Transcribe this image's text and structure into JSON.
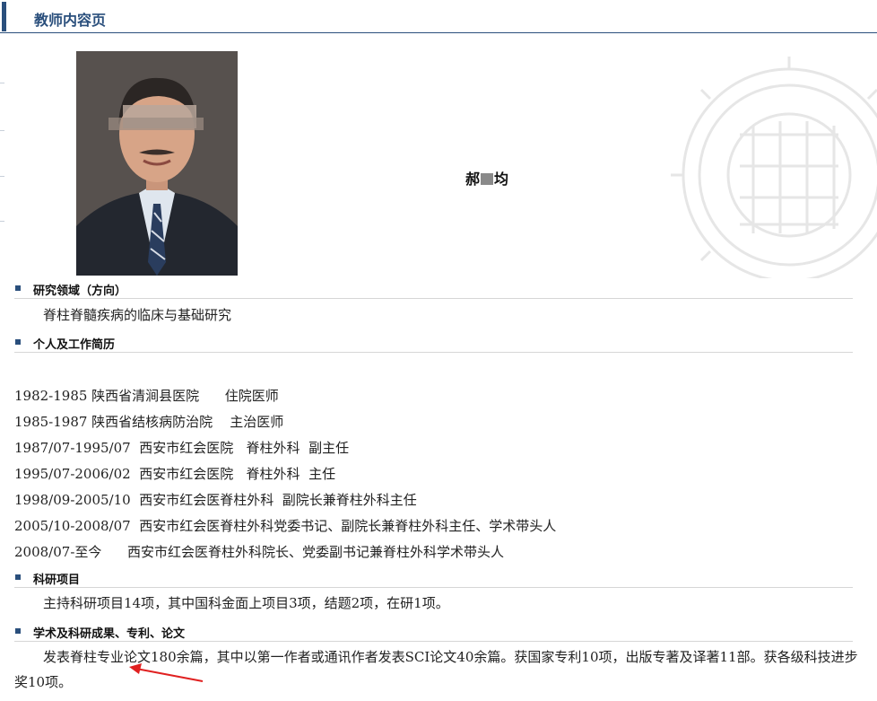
{
  "header": {
    "title": "教师内容页"
  },
  "teacher": {
    "name_part1": "郝",
    "name_part2": "均"
  },
  "sections": {
    "research_area": {
      "title": "研究领域（方向）",
      "text": "脊柱脊髓疾病的临床与基础研究"
    },
    "career": {
      "title": "个人及工作简历",
      "entries": [
        "1982-1985 陕西省清涧县医院      住院医师",
        "1985-1987 陕西省结核病防治院    主治医师",
        "1987/07-1995/07  西安市红会医院   脊柱外科  副主任",
        "1995/07-2006/02  西安市红会医院   脊柱外科  主任",
        "1998/09-2005/10  西安市红会医脊柱外科  副院长兼脊柱外科主任",
        "2005/10-2008/07  西安市红会医脊柱外科党委书记、副院长兼脊柱外科主任、学术带头人",
        "2008/07-至今      西安市红会医脊柱外科院长、党委副书记兼脊柱外科学术带头人"
      ]
    },
    "projects": {
      "title": "科研项目",
      "text": "主持科研项目14项，其中国科金面上项目3项，结题2项，在研1项。"
    },
    "achievements": {
      "title": "学术及科研成果、专利、论文",
      "text": "发表脊柱专业论文180余篇，其中以第一作者或通讯作者发表SCI论文40余篇。获国家专利10项，出版专著及译著11部。获各级科技进步奖10项。"
    }
  },
  "colors": {
    "accent": "#2a4f7c",
    "annotation_arrow": "#e02020",
    "divider": "#d6d6d6"
  }
}
